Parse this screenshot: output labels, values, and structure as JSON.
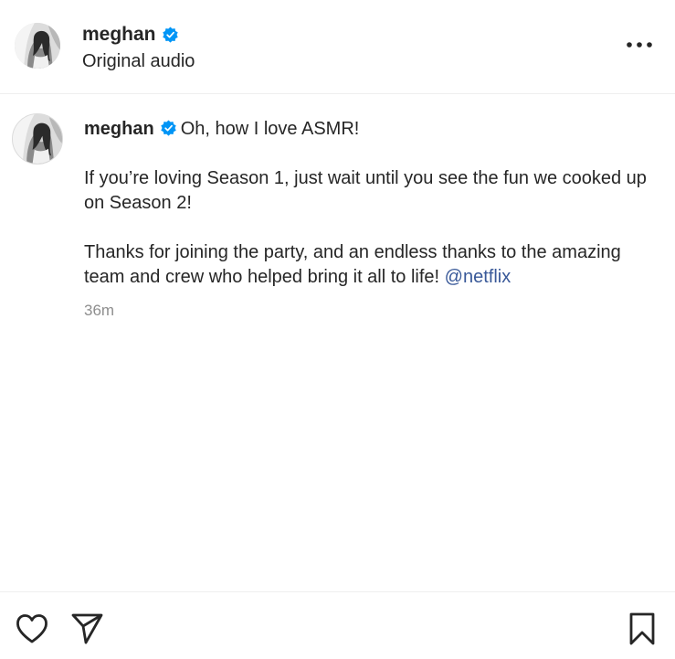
{
  "post": {
    "username": "meghan",
    "subtitle": "Original audio"
  },
  "comment": {
    "username": "meghan",
    "first_line": "Oh, how I love ASMR!",
    "paragraph_1": "If you’re loving Season 1, just wait until you see the fun we cooked up on Season 2!",
    "paragraph_2": "Thanks for joining the party, and an endless thanks to the amazing team and crew who helped bring it all to life!",
    "mention": "@netflix",
    "time": "36m"
  },
  "icons": {
    "more": "more-horizontal-icon",
    "verified": "verified-badge-icon",
    "like": "heart-icon",
    "share": "paper-plane-icon",
    "save": "bookmark-icon"
  },
  "colors": {
    "verified": "#0095f6",
    "mention": "#385898",
    "muted": "#8e8e8e",
    "text": "#262626"
  }
}
